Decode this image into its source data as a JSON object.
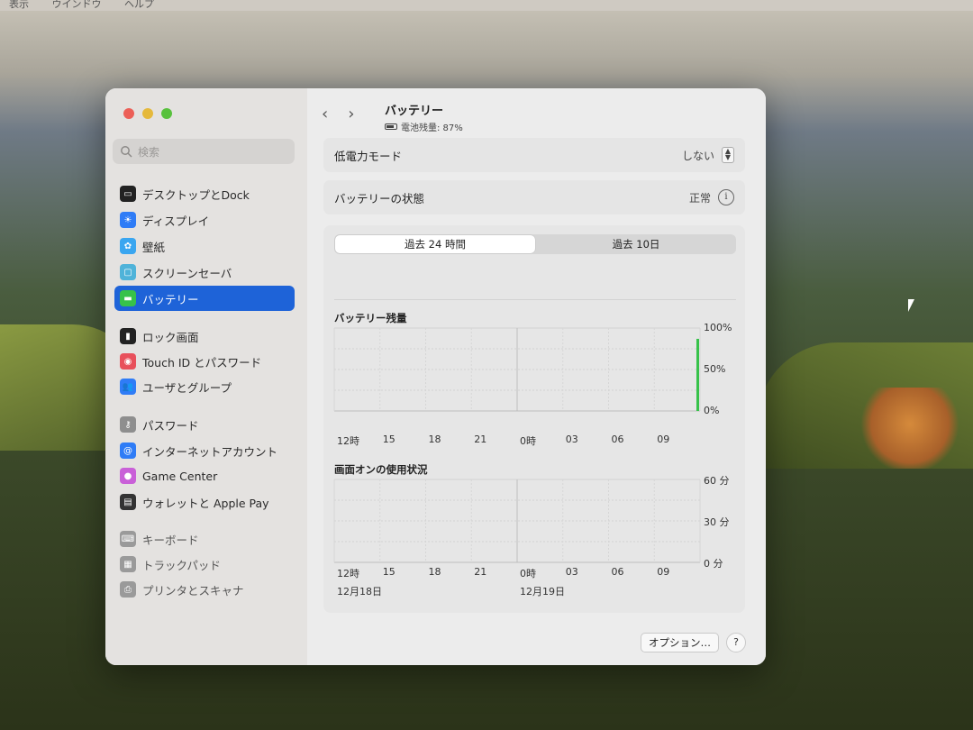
{
  "menubar": {
    "items": [
      "表示",
      "ウインドウ",
      "ヘルプ"
    ]
  },
  "sidebar": {
    "search_placeholder": "検索",
    "items": [
      {
        "label": "デスクトップとDock",
        "icon": "dock-icon",
        "color": "#222222"
      },
      {
        "label": "ディスプレイ",
        "icon": "display-icon",
        "color": "#2f7cf6"
      },
      {
        "label": "壁紙",
        "icon": "wallpaper-icon",
        "color": "#3aa6f0"
      },
      {
        "label": "スクリーンセーバ",
        "icon": "screensaver-icon",
        "color": "#4fb3d9"
      },
      {
        "label": "バッテリー",
        "icon": "battery-icon",
        "color": "#37c24a",
        "active": true
      },
      {
        "label": "ロック画面",
        "icon": "lock-icon",
        "color": "#222222"
      },
      {
        "label": "Touch ID とパスワード",
        "icon": "fingerprint-icon",
        "color": "#e8505b"
      },
      {
        "label": "ユーザとグループ",
        "icon": "users-icon",
        "color": "#2f7cf6"
      },
      {
        "label": "パスワード",
        "icon": "key-icon",
        "color": "#8e8e8e"
      },
      {
        "label": "インターネットアカウント",
        "icon": "at-icon",
        "color": "#2f7cf6"
      },
      {
        "label": "Game Center",
        "icon": "game-center-icon",
        "color": "#c960d8"
      },
      {
        "label": "ウォレットと Apple Pay",
        "icon": "wallet-icon",
        "color": "#333333"
      },
      {
        "label": "キーボード",
        "icon": "keyboard-icon",
        "color": "#9a9a9a"
      },
      {
        "label": "トラックパッド",
        "icon": "trackpad-icon",
        "color": "#9a9a9a"
      },
      {
        "label": "プリンタとスキャナ",
        "icon": "printer-icon",
        "color": "#9a9a9a"
      }
    ]
  },
  "header": {
    "title": "バッテリー",
    "subtitle": "電池残量: 87%"
  },
  "rows": {
    "low_power": {
      "label": "低電力モード",
      "value": "しない"
    },
    "health": {
      "label": "バッテリーの状態",
      "value": "正常"
    }
  },
  "tabs": {
    "tab1": "過去 24 時間",
    "tab2": "過去 10日"
  },
  "chart_data": [
    {
      "type": "bar",
      "title": "バッテリー残量",
      "categories": [
        "12時",
        "15",
        "18",
        "21",
        "0時",
        "03",
        "06",
        "09"
      ],
      "y_ticks": [
        "100%",
        "50%",
        "0%"
      ],
      "ylim": [
        0,
        100
      ],
      "series": [
        {
          "values": [
            null,
            null,
            null,
            null,
            null,
            null,
            null,
            null,
            87
          ]
        }
      ],
      "grid": true,
      "color": "#37c24a"
    },
    {
      "type": "bar",
      "title": "画面オンの使用状況",
      "categories": [
        "12時",
        "15",
        "18",
        "21",
        "0時",
        "03",
        "06",
        "09"
      ],
      "y_ticks": [
        "60 分",
        "30 分",
        "0 分"
      ],
      "ylim": [
        0,
        60
      ],
      "dates": [
        "12月18日",
        "12月19日"
      ],
      "series": [],
      "grid": true
    }
  ],
  "footer": {
    "options_label": "オプション…",
    "help_label": "?"
  }
}
